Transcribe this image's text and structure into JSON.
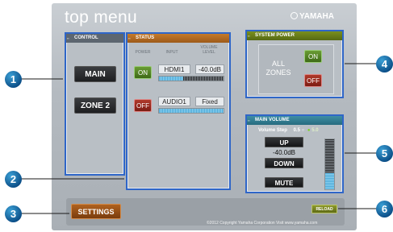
{
  "app": {
    "title": "top menu",
    "brand": "YAMAHA"
  },
  "control": {
    "heading": "CONTROL",
    "buttons": [
      "MAIN",
      "ZONE 2"
    ]
  },
  "status": {
    "heading": "STATUS",
    "columns": {
      "power": "POWER",
      "input": "INPUT",
      "volume": "VOLUME LEVEL"
    },
    "rows": [
      {
        "power": "ON",
        "input": "HDMI1",
        "volume": "-40.0dB",
        "meter_level": 0.37
      },
      {
        "power": "OFF",
        "input": "AUDIO1",
        "volume": "Fixed",
        "meter_level": 1.0
      }
    ],
    "colors": {
      "on": "#4e8022",
      "off": "#9a2a1e"
    }
  },
  "system_power": {
    "heading": "SYSTEM POWER",
    "label_line1": "ALL",
    "label_line2": "ZONES",
    "on_label": "ON",
    "off_label": "OFF"
  },
  "main_volume": {
    "heading": "MAIN VOLUME",
    "step_label": "Volume Step",
    "step_options": [
      "0.5",
      "5.0"
    ],
    "up_label": "UP",
    "level": "-40.0dB",
    "down_label": "DOWN",
    "mute_label": "MUTE",
    "meter_level": 0.33
  },
  "footer": {
    "settings_label": "SETTINGS",
    "reload_label": "RELOAD",
    "copyright": "©2012 Copyright Yamaha Corporation Visit www.yamaha.com"
  },
  "callouts": [
    "1",
    "2",
    "3",
    "4",
    "5",
    "6"
  ],
  "accent_colors": {
    "panel_border": "#2f66c8",
    "callout": "#0b4d86"
  }
}
